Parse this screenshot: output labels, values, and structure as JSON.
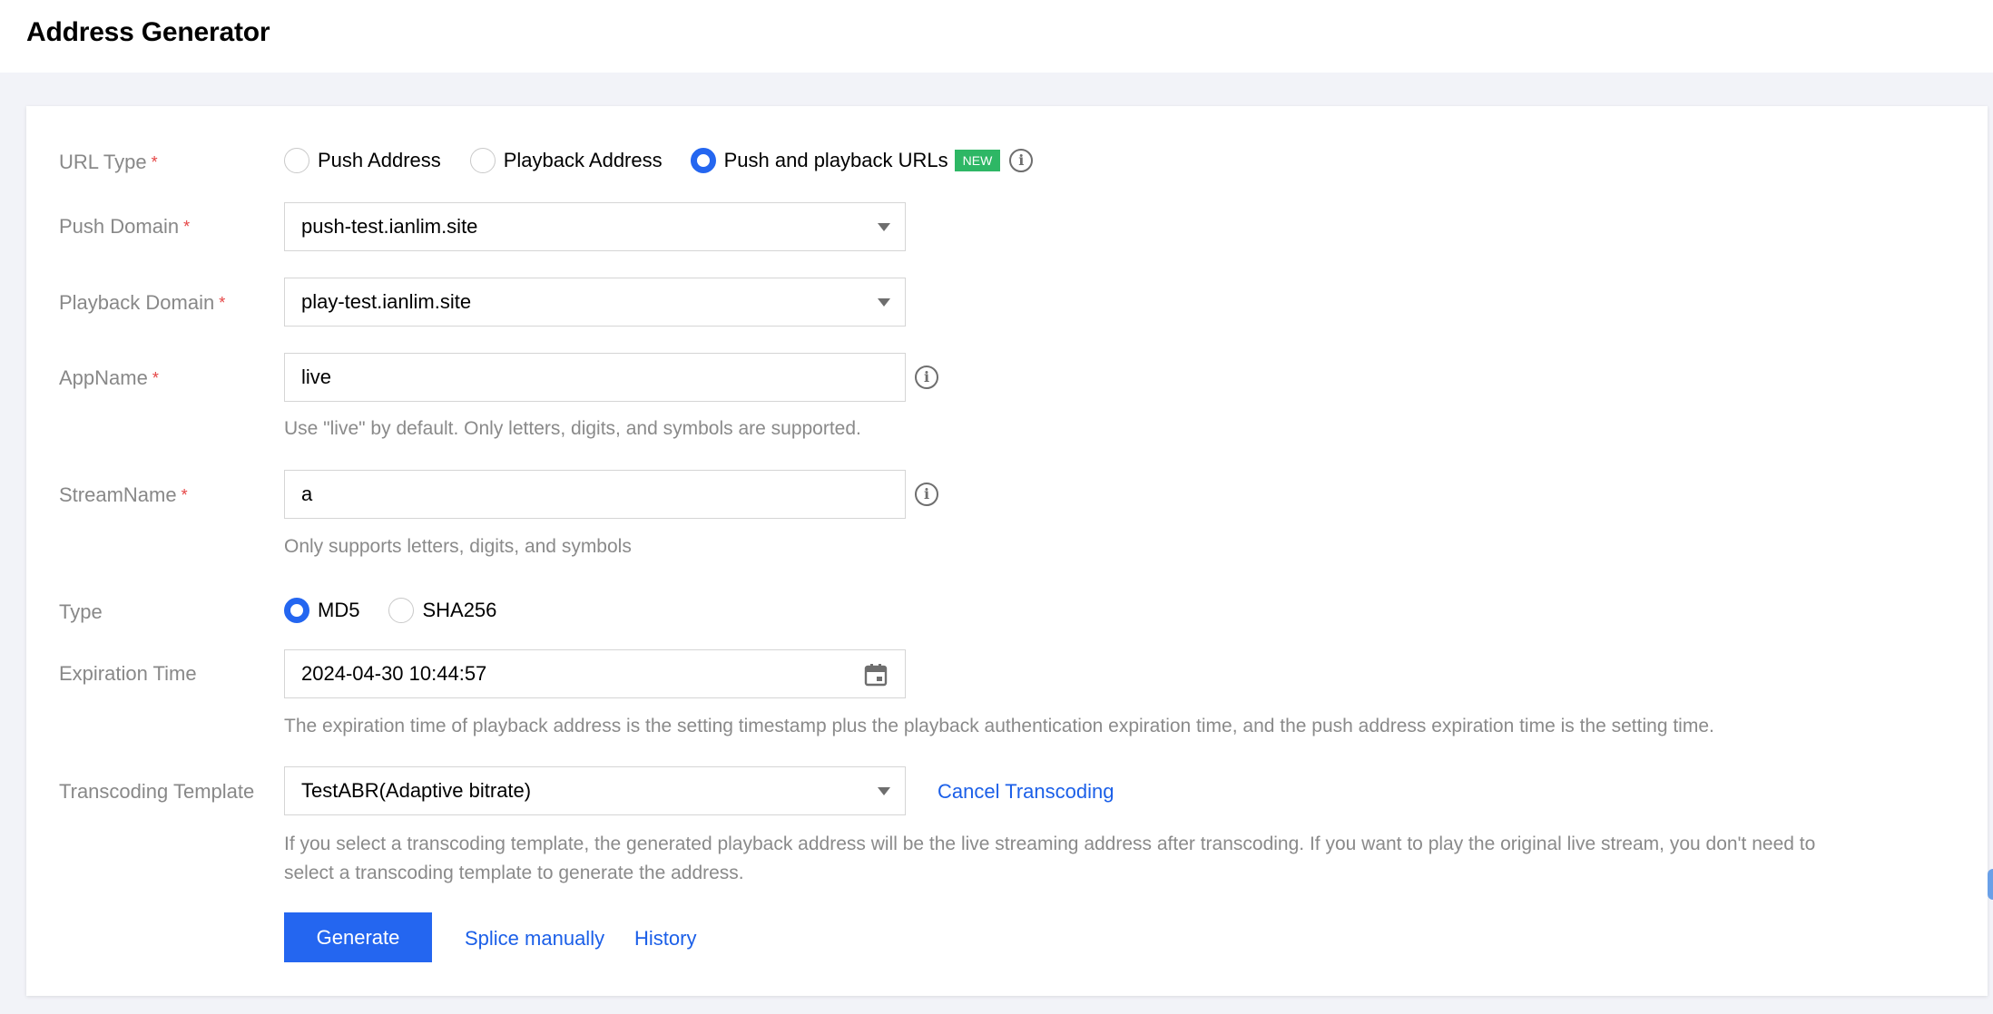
{
  "header": {
    "title": "Address Generator"
  },
  "form": {
    "url_type": {
      "label": "URL Type",
      "required_mark": "*",
      "options": [
        {
          "label": "Push Address",
          "checked": false
        },
        {
          "label": "Playback Address",
          "checked": false
        },
        {
          "label": "Push and playback URLs",
          "checked": true,
          "badge": "NEW"
        }
      ]
    },
    "push_domain": {
      "label": "Push Domain",
      "required_mark": "*",
      "value": "push-test.ianlim.site"
    },
    "playback_domain": {
      "label": "Playback Domain",
      "required_mark": "*",
      "value": "play-test.ianlim.site"
    },
    "app_name": {
      "label": "AppName",
      "required_mark": "*",
      "value": "live",
      "hint": "Use \"live\" by default. Only letters, digits, and symbols are supported."
    },
    "stream_name": {
      "label": "StreamName",
      "required_mark": "*",
      "value": "a",
      "hint": "Only supports letters, digits, and symbols"
    },
    "type": {
      "label": "Type",
      "options": [
        {
          "label": "MD5",
          "checked": true
        },
        {
          "label": "SHA256",
          "checked": false
        }
      ]
    },
    "expiration_time": {
      "label": "Expiration Time",
      "value": "2024-04-30 10:44:57",
      "hint": "The expiration time of playback address is the setting timestamp plus the playback authentication expiration time, and the push address expiration time is the setting time."
    },
    "transcoding_template": {
      "label": "Transcoding Template",
      "value": "TestABR(Adaptive bitrate)",
      "cancel_link": "Cancel Transcoding",
      "hint_line1": "If you select a transcoding template, the generated playback address will be the live streaming address after transcoding. If you want to play the original live stream, you don't need to",
      "hint_line2": "select a transcoding template to generate the address."
    },
    "actions": {
      "generate": "Generate",
      "splice_manually": "Splice manually",
      "history": "History"
    }
  },
  "colors": {
    "primary": "#2466f0",
    "link": "#1b5fe8",
    "required": "#e54545",
    "badge_new": "#2eb765"
  }
}
